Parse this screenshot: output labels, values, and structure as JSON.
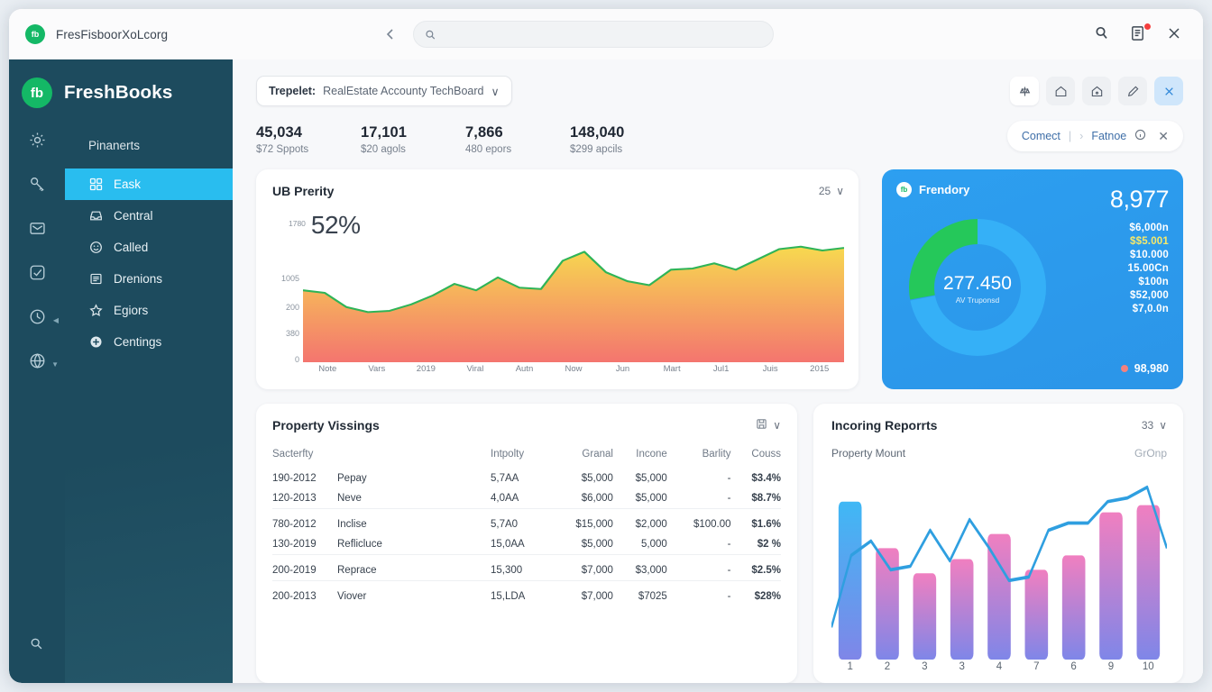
{
  "browser": {
    "favicon_text": "fb",
    "url": "FresFisboorXoLcorg",
    "omnibox_placeholder": "",
    "omnibox_value": "",
    "back_icon": "chevron-left-icon",
    "search_icon": "search-icon",
    "notes_icon": "notes-icon",
    "close_icon": "close-icon"
  },
  "rail": {
    "icons": [
      "settings-gear-icon",
      "key-icon",
      "mail-icon",
      "check-square-icon",
      "clock-icon",
      "globe-icon"
    ],
    "bottom_icon": "search-icon"
  },
  "sidebar": {
    "brand": "FreshBooks",
    "brand_logo_text": "fb",
    "section_title": "Pinanerts",
    "items": [
      {
        "label": "Eask",
        "icon": "dashboard-icon",
        "active": true
      },
      {
        "label": "Central",
        "icon": "inbox-icon",
        "active": false
      },
      {
        "label": "Called",
        "icon": "smiley-icon",
        "active": false
      },
      {
        "label": "Drenions",
        "icon": "list-icon",
        "active": false
      },
      {
        "label": "Egiors",
        "icon": "star-icon",
        "active": false
      },
      {
        "label": "Centings",
        "icon": "plus-circle-icon",
        "active": false
      }
    ]
  },
  "toolbar": {
    "project_prefix": "Trepelet:",
    "project_name": "RealEstate Accounty TechBoard",
    "chevron": "∨",
    "buttons": [
      {
        "name": "balance-button",
        "icon": "⚕",
        "active": false,
        "first": true
      },
      {
        "name": "home-button",
        "icon": "⌂",
        "active": false,
        "first": false
      },
      {
        "name": "lock-button",
        "icon": "⌂",
        "active": false,
        "first": false
      },
      {
        "name": "edit-button",
        "icon": "✎",
        "active": false,
        "first": false
      },
      {
        "name": "close-button",
        "icon": "✕",
        "active": true,
        "first": false
      }
    ]
  },
  "metrics": [
    {
      "value": "45,034",
      "label": "$72 Sppots"
    },
    {
      "value": "17,101",
      "label": "$20 agols"
    },
    {
      "value": "7,866",
      "label": "480 epors"
    },
    {
      "value": "148,040",
      "label": "$299 apcils"
    }
  ],
  "status_pill": {
    "primary": "Comect",
    "separator": "|",
    "chevron": "›",
    "secondary": "Fatnoe",
    "info_icon": "info-icon",
    "close_icon": "close-icon"
  },
  "chart_card": {
    "title": "UB Prerity",
    "range": "25",
    "chevron": "∨",
    "top_tick": "1780",
    "big_stat": "52%"
  },
  "donut_card": {
    "brand": "Frendory",
    "brand_logo_text": "fb",
    "big_value": "8,977",
    "center_value": "277.450",
    "center_sub": "AV Truponsd",
    "list": [
      {
        "value": "$6,000n",
        "highlight": false
      },
      {
        "value": "$$5.001",
        "highlight": true
      },
      {
        "value": "$10.000",
        "highlight": false
      },
      {
        "value": "15.00Cn",
        "highlight": false
      },
      {
        "value": "$100n",
        "highlight": false
      },
      {
        "value": "$52,000",
        "highlight": false
      },
      {
        "value": "$7,0.0n",
        "highlight": false
      }
    ],
    "footer_value": "98,980",
    "footer_dot_color": "#f4817e"
  },
  "table_card": {
    "title": "Property Vissings",
    "save_icon": "save-icon",
    "chevron": "∨",
    "columns": [
      "Sacterfty",
      "",
      "Intpolty",
      "Granal",
      "Incone",
      "Barlity",
      "Couss"
    ],
    "rows": [
      {
        "date": "190-2012",
        "name": "Pepay",
        "intpolty": "5,7AA",
        "granal": "$5,000",
        "incone": "$5,000",
        "barlity": "-",
        "couss": "$3.4%",
        "trend": "pos",
        "group": 0
      },
      {
        "date": "120-2013",
        "name": "Neve",
        "intpolty": "4,0AA",
        "granal": "$6,000",
        "incone": "$5,000",
        "barlity": "-",
        "couss": "$8.7%",
        "trend": "neg",
        "group": 0
      },
      {
        "date": "780-2012",
        "name": "Inclise",
        "intpolty": "5,7A0",
        "granal": "$15,000",
        "incone": "$2,000",
        "barlity": "$100.00",
        "couss": "$1.6%",
        "trend": "neg",
        "group": 1
      },
      {
        "date": "130-2019",
        "name": "Reflicluce",
        "intpolty": "15,0AA",
        "granal": "$5,000",
        "incone": "5,000",
        "barlity": "-",
        "couss": "$2 %",
        "trend": "pos",
        "group": 1
      },
      {
        "date": "200-2019",
        "name": "Reprace",
        "intpolty": "15,300",
        "granal": "$7,000",
        "incone": "$3,000",
        "barlity": "-",
        "couss": "$2.5%",
        "trend": "pos",
        "group": 2
      },
      {
        "date": "200-2013",
        "name": "Viover",
        "intpolty": "15,LDA",
        "granal": "$7,000",
        "incone": "$7025",
        "barlity": "-",
        "couss": "$28%",
        "trend": "neg",
        "group": 3
      }
    ]
  },
  "bars_card": {
    "title": "Incoring Reporrts",
    "range": "33",
    "chevron": "∨",
    "sub_left": "Property Mount",
    "sub_right": "GrOnp"
  },
  "chart_data": [
    {
      "type": "area",
      "title": "UB Prerity",
      "xlabel": "",
      "ylabel": "",
      "x": [
        "Note",
        "Vars",
        "2019",
        "Viral",
        "Autn",
        "Now",
        "Jun",
        "Mart",
        "Jul1",
        "Juis",
        "2015"
      ],
      "y_ticks": [
        "1780",
        "1005",
        "200",
        "380",
        "0"
      ],
      "ylim": [
        0,
        1005
      ],
      "grid": false,
      "line_color": "#2fb457",
      "fill_gradient": [
        "#f7d94f",
        "#f4756f"
      ],
      "values": [
        560,
        540,
        430,
        390,
        400,
        450,
        520,
        610,
        560,
        660,
        580,
        570,
        790,
        860,
        700,
        630,
        600,
        720,
        730,
        770,
        720,
        800,
        880,
        900,
        870,
        890
      ]
    },
    {
      "type": "pie",
      "title": "Frendory",
      "labels": [
        "segment-blue",
        "segment-green"
      ],
      "values": [
        72,
        28
      ],
      "colors": [
        "#35b0f7",
        "#25c85a"
      ],
      "center_value": "277.450",
      "center_sub": "AV Truponsd"
    },
    {
      "type": "bar",
      "title": "Incoring Reporrts",
      "categories": [
        "1",
        "2",
        "3",
        "3",
        "4",
        "7",
        "6",
        "9",
        "10"
      ],
      "values": [
        88,
        62,
        48,
        56,
        70,
        50,
        58,
        82,
        86
      ],
      "line_series": {
        "name": "trend",
        "values": [
          18,
          58,
          66,
          50,
          52,
          72,
          55,
          78,
          62,
          44,
          46,
          72,
          76,
          76,
          88,
          90,
          96,
          62
        ],
        "color": "#2f9fe0"
      },
      "bar_gradient": [
        "#f07fc0",
        "#7f86e8"
      ],
      "first_bar_gradient": [
        "#3fb8f5",
        "#7f86e8"
      ],
      "ylim": [
        0,
        100
      ],
      "grid": false
    }
  ]
}
